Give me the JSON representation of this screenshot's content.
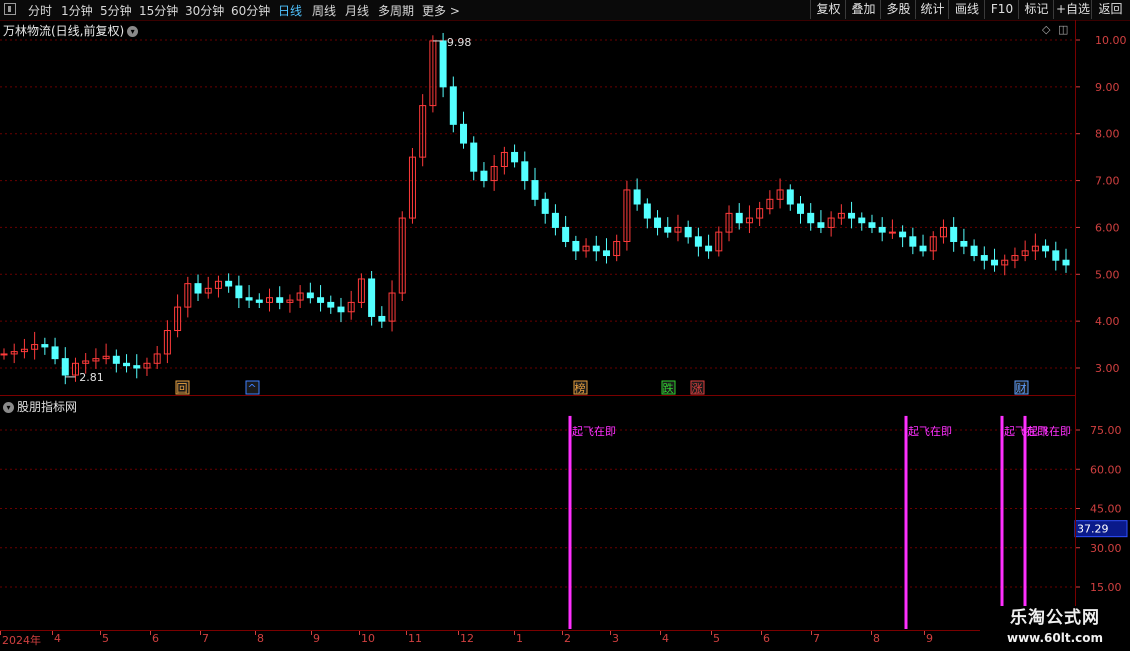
{
  "toolbar": {
    "periods": [
      "分时",
      "1分钟",
      "5分钟",
      "15分钟",
      "30分钟",
      "60分钟",
      "日线",
      "周线",
      "月线",
      "多周期",
      "更多 >"
    ],
    "active_period": "日线",
    "right_buttons": [
      "复权",
      "叠加",
      "多股",
      "统计",
      "画线",
      "F10",
      "标记",
      "+自选",
      "返回"
    ]
  },
  "main": {
    "stock_title": "万林物流(日线,前复权)",
    "high_label": "9.98",
    "low_label": "2.81",
    "price_ticks": [
      "10.00",
      "9.00",
      "8.00",
      "7.00",
      "6.00",
      "5.00",
      "4.00",
      "3.00"
    ],
    "event_markers": [
      {
        "text": "回",
        "color": "#e8a040"
      },
      {
        "text": "^",
        "color": "#4080ff"
      },
      {
        "text": "榜",
        "color": "#e8a040"
      },
      {
        "text": "跌",
        "color": "#30d030"
      },
      {
        "text": "涨",
        "color": "#e04040"
      },
      {
        "text": "财",
        "color": "#60a0ff"
      }
    ]
  },
  "indicator": {
    "title": "股朋指标网",
    "value_ticks": [
      "75.00",
      "60.00",
      "45.00",
      "30.00",
      "15.00"
    ],
    "current_value": "37.29",
    "signal_text": "起飞在即",
    "bar_color": "#ff30ff"
  },
  "date_axis": {
    "labels": [
      "2024年",
      "4",
      "5",
      "6",
      "7",
      "8",
      "9",
      "10",
      "11",
      "12",
      "1",
      "2",
      "3",
      "4",
      "5",
      "6",
      "7",
      "8",
      "9"
    ]
  },
  "watermark": {
    "line1": "乐淘公式网",
    "line2": "www.60lt.com"
  },
  "colors": {
    "up": "#ff3b3b",
    "down": "#54ffff",
    "axis": "#d04040",
    "active": "#4fc3ff"
  },
  "chart_data": {
    "type": "candlestick",
    "y_range": [
      2.6,
      10.3
    ],
    "ohlc_approx": [
      3.3,
      3.35,
      3.4,
      3.5,
      3.45,
      3.2,
      2.85,
      3.1,
      3.15,
      3.2,
      3.25,
      3.1,
      3.05,
      3.0,
      3.1,
      3.3,
      3.8,
      4.3,
      4.8,
      4.6,
      4.7,
      4.85,
      4.75,
      4.5,
      4.45,
      4.4,
      4.5,
      4.4,
      4.45,
      4.6,
      4.5,
      4.4,
      4.3,
      4.2,
      4.4,
      4.9,
      4.1,
      4.0,
      4.6,
      6.2,
      7.5,
      8.6,
      9.98,
      9.0,
      8.2,
      7.8,
      7.2,
      7.0,
      7.3,
      7.6,
      7.4,
      7.0,
      6.6,
      6.3,
      6.0,
      5.7,
      5.5,
      5.6,
      5.5,
      5.4,
      5.7,
      6.8,
      6.5,
      6.2,
      6.0,
      5.9,
      6.0,
      5.8,
      5.6,
      5.5,
      5.9,
      6.3,
      6.1,
      6.2,
      6.4,
      6.6,
      6.8,
      6.5,
      6.3,
      6.1,
      6.0,
      6.2,
      6.3,
      6.2,
      6.1,
      6.0,
      5.9,
      5.9,
      5.8,
      5.6,
      5.5,
      5.8,
      6.0,
      5.7,
      5.6,
      5.4,
      5.3,
      5.2,
      5.3,
      5.4,
      5.5,
      5.6,
      5.5,
      5.3,
      5.2
    ],
    "indicator_signals": [
      {
        "label": "起飞在即",
        "value": 80
      },
      {
        "label": "起飞在即",
        "value": 80
      },
      {
        "label": "起飞在即",
        "value": 80
      },
      {
        "label": "起飞在即",
        "value": 80
      }
    ],
    "indicator_range": [
      10,
      85
    ]
  }
}
